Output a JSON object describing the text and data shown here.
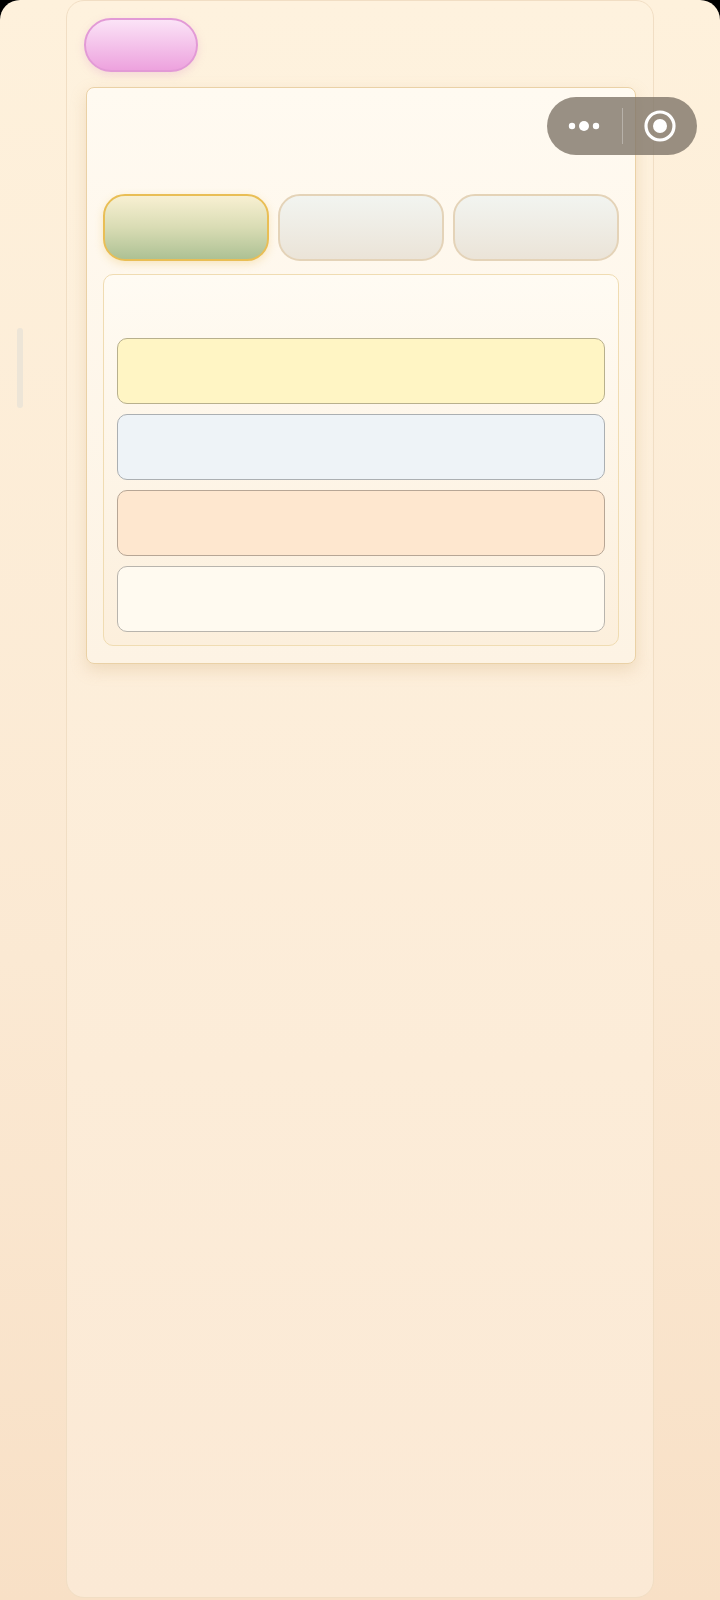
{
  "tabs": [
    {
      "selected": true
    },
    {
      "selected": false
    },
    {
      "selected": false
    }
  ],
  "options": [
    {
      "color": "#fff5c4"
    },
    {
      "color": "#eef3f7"
    },
    {
      "color": "#fee7cf"
    },
    {
      "color": "#fffaf0"
    }
  ]
}
